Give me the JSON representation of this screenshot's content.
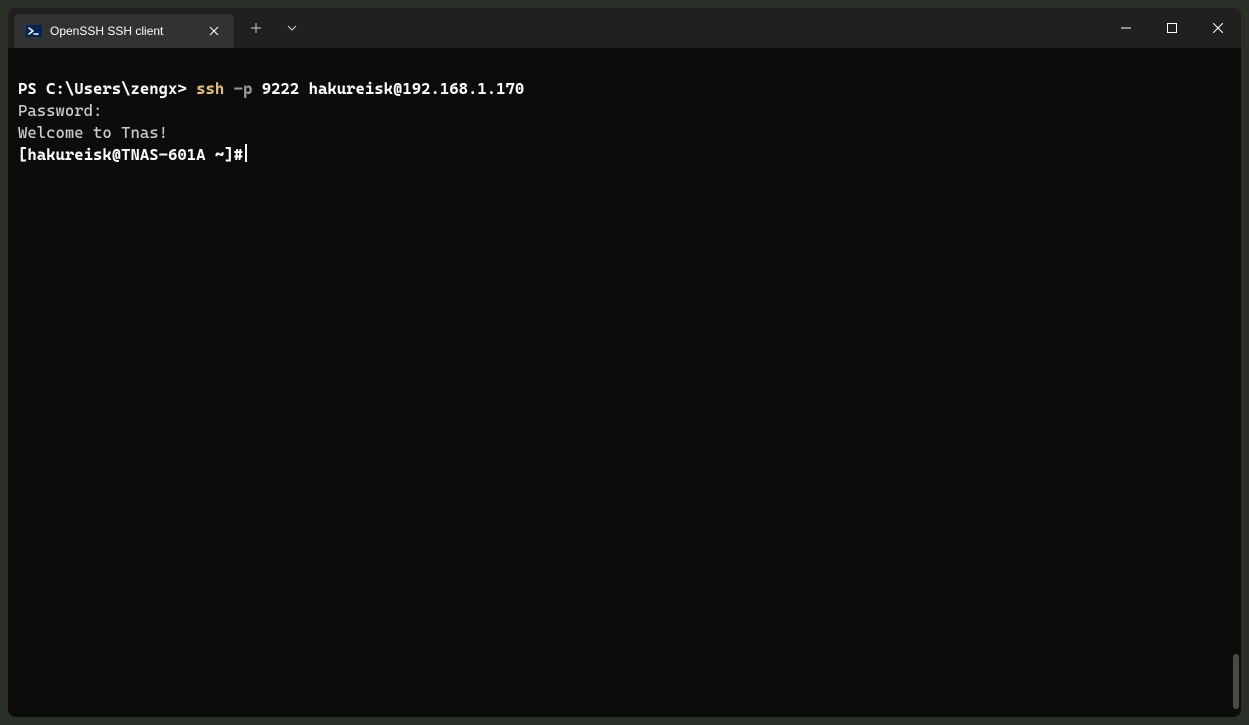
{
  "tab": {
    "title": "OpenSSH SSH client"
  },
  "terminal": {
    "line1": {
      "prompt": "PS C:\\Users\\zengx> ",
      "cmd_ssh": "ssh",
      "cmd_flag": " -p",
      "cmd_rest": " 9222 hakureisk@192.168.1.170"
    },
    "line2": "Password:",
    "line3": "Welcome to Tnas!",
    "line4_prompt": "[hakureisk@TNAS-601A ~]#"
  }
}
